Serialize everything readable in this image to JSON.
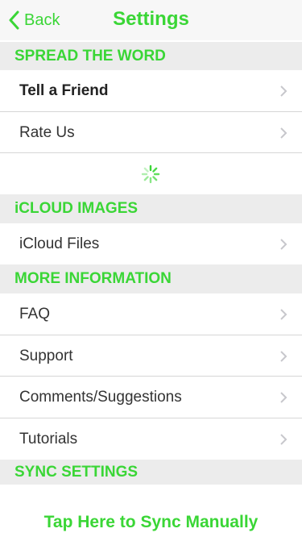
{
  "nav": {
    "back_label": "Back",
    "title": "Settings"
  },
  "sections": {
    "spread": "SPREAD THE WORD",
    "icloud": "iCLOUD IMAGES",
    "more": "MORE INFORMATION",
    "sync": "SYNC SETTINGS"
  },
  "rows": {
    "tell_friend": "Tell a Friend",
    "rate_us": "Rate Us",
    "icloud_files": "iCloud Files",
    "faq": "FAQ",
    "support": "Support",
    "comments": "Comments/Suggestions",
    "tutorials": "Tutorials"
  },
  "sync_link": "Tap Here to Sync Manually",
  "colors": {
    "accent": "#3ad636",
    "header_bg": "#ececec",
    "chevron": "#c7c7cc"
  },
  "icons": {
    "back": "chevron-left-icon",
    "row": "chevron-right-icon",
    "loading": "spinner-icon"
  }
}
